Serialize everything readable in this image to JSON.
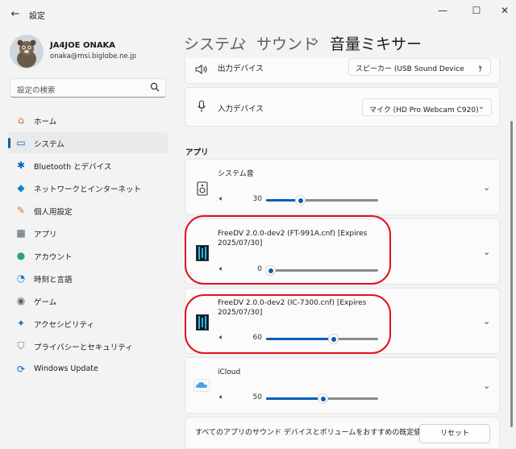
{
  "window": {
    "title": "設定",
    "back_glyph": "←",
    "minimize_glyph": "—",
    "maximize_glyph": "☐",
    "close_glyph": "✕"
  },
  "account": {
    "name": "JA4JOE ONAKA",
    "email": "onaka@msi.biglobe.ne.jp"
  },
  "search": {
    "placeholder": "設定の検索",
    "icon": "search-icon"
  },
  "nav": {
    "items": [
      {
        "label": "ホーム",
        "icon": "home-icon",
        "glyph": "⌂",
        "color": "#e05a2b"
      },
      {
        "label": "システム",
        "icon": "system-icon",
        "glyph": "▭",
        "color": "#0067c0",
        "active": true
      },
      {
        "label": "Bluetooth とデバイス",
        "icon": "bluetooth-icon",
        "glyph": "✱",
        "color": "#0067c0"
      },
      {
        "label": "ネットワークとインターネット",
        "icon": "wifi-icon",
        "glyph": "◆",
        "color": "#1a7dc8"
      },
      {
        "label": "個人用設定",
        "icon": "brush-icon",
        "glyph": "✎",
        "color": "#d07a2a"
      },
      {
        "label": "アプリ",
        "icon": "apps-icon",
        "glyph": "▦",
        "color": "#4a5a6a"
      },
      {
        "label": "アカウント",
        "icon": "account-icon",
        "glyph": "●",
        "color": "#28a08c"
      },
      {
        "label": "時刻と言語",
        "icon": "globe-clock-icon",
        "glyph": "◔",
        "color": "#1a7dc8"
      },
      {
        "label": "ゲーム",
        "icon": "gamepad-icon",
        "glyph": "◉",
        "color": "#5a6470"
      },
      {
        "label": "アクセシビリティ",
        "icon": "accessibility-icon",
        "glyph": "✦",
        "color": "#1a6fd0"
      },
      {
        "label": "プライバシーとセキュリティ",
        "icon": "shield-icon",
        "glyph": "⛉",
        "color": "#6a737d"
      },
      {
        "label": "Windows Update",
        "icon": "update-icon",
        "glyph": "⟳",
        "color": "#0067c0"
      }
    ]
  },
  "breadcrumb": {
    "level1": "システム",
    "level2": "サウンド",
    "current": "音量ミキサー",
    "separator": "›"
  },
  "devices": {
    "output_label": "出力デバイス",
    "output_value": "スピーカー (USB Sound Device　　)",
    "input_label": "入力デバイス",
    "input_value": "マイク (HD Pro Webcam C920)"
  },
  "apps_section": {
    "title": "アプリ",
    "items": [
      {
        "name": "システム音",
        "volume": 30,
        "icon": "speaker-device-icon"
      },
      {
        "name": "FreeDV 2.0.0-dev2 (FT-991A.cnf) [Expires 2025/07/30]",
        "volume": 0,
        "icon": "freedv-icon",
        "highlighted": true
      },
      {
        "name": "FreeDV 2.0.0-dev2 (IC-7300.cnf) [Expires 2025/07/30]",
        "volume": 60,
        "icon": "freedv-icon",
        "highlighted": true
      },
      {
        "name": "iCloud",
        "volume": 50,
        "icon": "icloud-icon"
      }
    ]
  },
  "reset": {
    "text": "すべてのアプリのサウンド デバイスとボリュームをおすすめの既定値にリ",
    "button": "リセット"
  },
  "colors": {
    "accent": "#005fb8",
    "highlight": "#e0101a"
  }
}
